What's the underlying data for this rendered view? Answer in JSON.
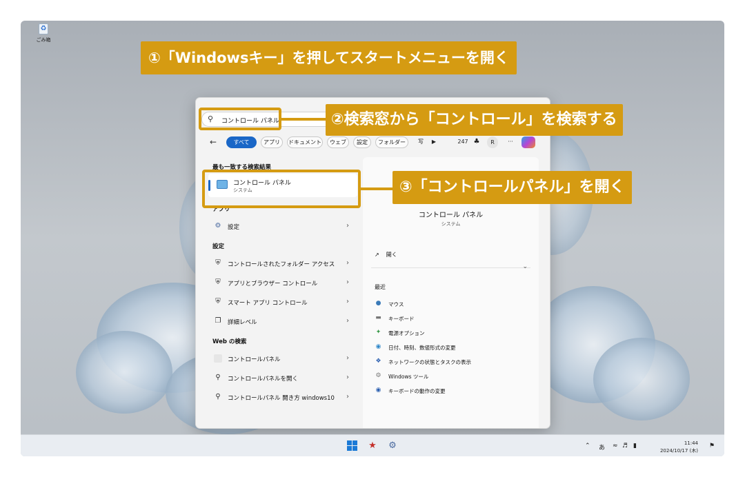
{
  "desktop": {
    "recycle_bin_label": "ごみ箱"
  },
  "annotations": {
    "step1": "①「Windowsキー」を押してスタートメニューを開く",
    "step2": "②検索窓から「コントロール」を検索する",
    "step3": "③「コントロールパネル」を開く",
    "color": "#d59b12"
  },
  "search": {
    "value": "コントロール パネル",
    "icon": "search-icon"
  },
  "filters": {
    "all": "すべて",
    "apps": "アプリ",
    "documents": "ドキュメント",
    "web": "ウェブ",
    "settings": "設定",
    "folders": "フォルダー",
    "photos": "写",
    "play": "▶",
    "points": "247",
    "avatar": "R",
    "more": "···"
  },
  "results": {
    "best_match_title": "最も一致する検索結果",
    "best": {
      "title": "コントロール パネル",
      "subtitle": "システム"
    },
    "apps_title": "アプリ",
    "apps": [
      {
        "label": "設定",
        "icon": "gear-icon"
      }
    ],
    "settings_title": "設定",
    "settings": [
      {
        "label": "コントロールされたフォルダー アクセス",
        "icon": "shield-icon"
      },
      {
        "label": "アプリとブラウザー コントロール",
        "icon": "shield-icon"
      },
      {
        "label": "スマート アプリ コントロール",
        "icon": "shield-icon"
      },
      {
        "label": "詳細レベル",
        "icon": "window-icon"
      }
    ],
    "web_title": "Web の検索",
    "web": [
      {
        "label": "コントロールパネル",
        "icon": "web-thumbnail-icon"
      },
      {
        "label": "コントロールパネルを開く",
        "icon": "search-icon"
      },
      {
        "label": "コントロールパネル 開き方 windows10",
        "icon": "search-icon"
      }
    ]
  },
  "preview": {
    "title": "コントロール パネル",
    "subtitle": "システム",
    "open": "開く",
    "recent_title": "最近",
    "recent": [
      {
        "label": "マウス",
        "icon": "mouse-icon"
      },
      {
        "label": "キーボード",
        "icon": "keyboard-icon"
      },
      {
        "label": "電源オプション",
        "icon": "power-plant-icon"
      },
      {
        "label": "日付、時刻、数値形式の変更",
        "icon": "globe-icon"
      },
      {
        "label": "ネットワークの状態とタスクの表示",
        "icon": "network-icon"
      },
      {
        "label": "Windows ツール",
        "icon": "tools-icon"
      },
      {
        "label": "キーボードの動作の変更",
        "icon": "keyboard-settings-icon"
      }
    ]
  },
  "taskbar": {
    "ime_mode": "あ",
    "time": "11:44",
    "date": "2024/10/17 (木)"
  }
}
